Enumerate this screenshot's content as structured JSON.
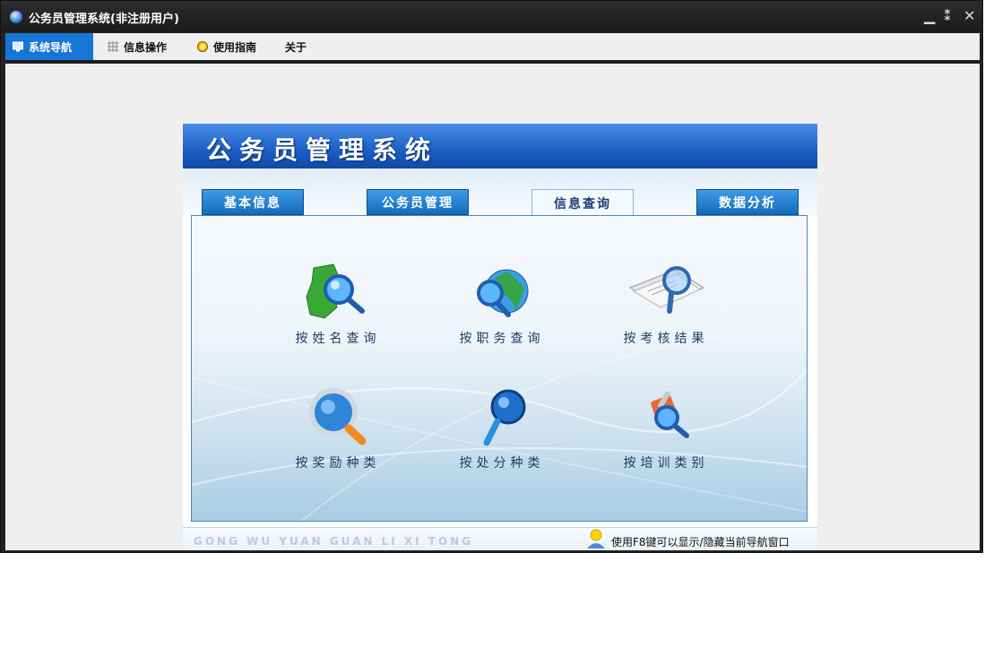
{
  "window": {
    "title": "公务员管理系统(非注册用户)",
    "controls": {
      "minimize": "▁",
      "restore": "⁑",
      "close": "✕"
    }
  },
  "menubar": {
    "tabs": [
      {
        "label": "系统导航",
        "icon": "monitor-icon",
        "active": true
      },
      {
        "label": "信息操作",
        "icon": "grid-icon",
        "active": false
      },
      {
        "label": "使用指南",
        "icon": "help-bulb-icon",
        "active": false
      },
      {
        "label": "关于",
        "icon": "",
        "active": false
      }
    ]
  },
  "panel": {
    "banner_title": "公务员管理系统",
    "tabs": [
      {
        "label": "基本信息",
        "active": false
      },
      {
        "label": "公务员管理",
        "active": false
      },
      {
        "label": "信息查询",
        "active": true
      },
      {
        "label": "数据分析",
        "active": false
      }
    ],
    "queries": [
      {
        "label": "按姓名查询",
        "icon": "map-magnifier-icon"
      },
      {
        "label": "按职务查询",
        "icon": "globe-magnifier-icon"
      },
      {
        "label": "按考核结果",
        "icon": "document-magnifier-icon"
      },
      {
        "label": "按奖励种类",
        "icon": "magnifier-icon"
      },
      {
        "label": "按处分种类",
        "icon": "blue-magnifier-icon"
      },
      {
        "label": "按培训类别",
        "icon": "tools-magnifier-icon"
      }
    ],
    "footer_left": "GONG WU YUAN GUAN LI XI TONG",
    "footer_right": "使用F8键可以显示/隐藏当前导航窗口"
  },
  "colors": {
    "accent": "#1676d8",
    "banner": "#1f62c9",
    "title_bar": "#222222"
  }
}
